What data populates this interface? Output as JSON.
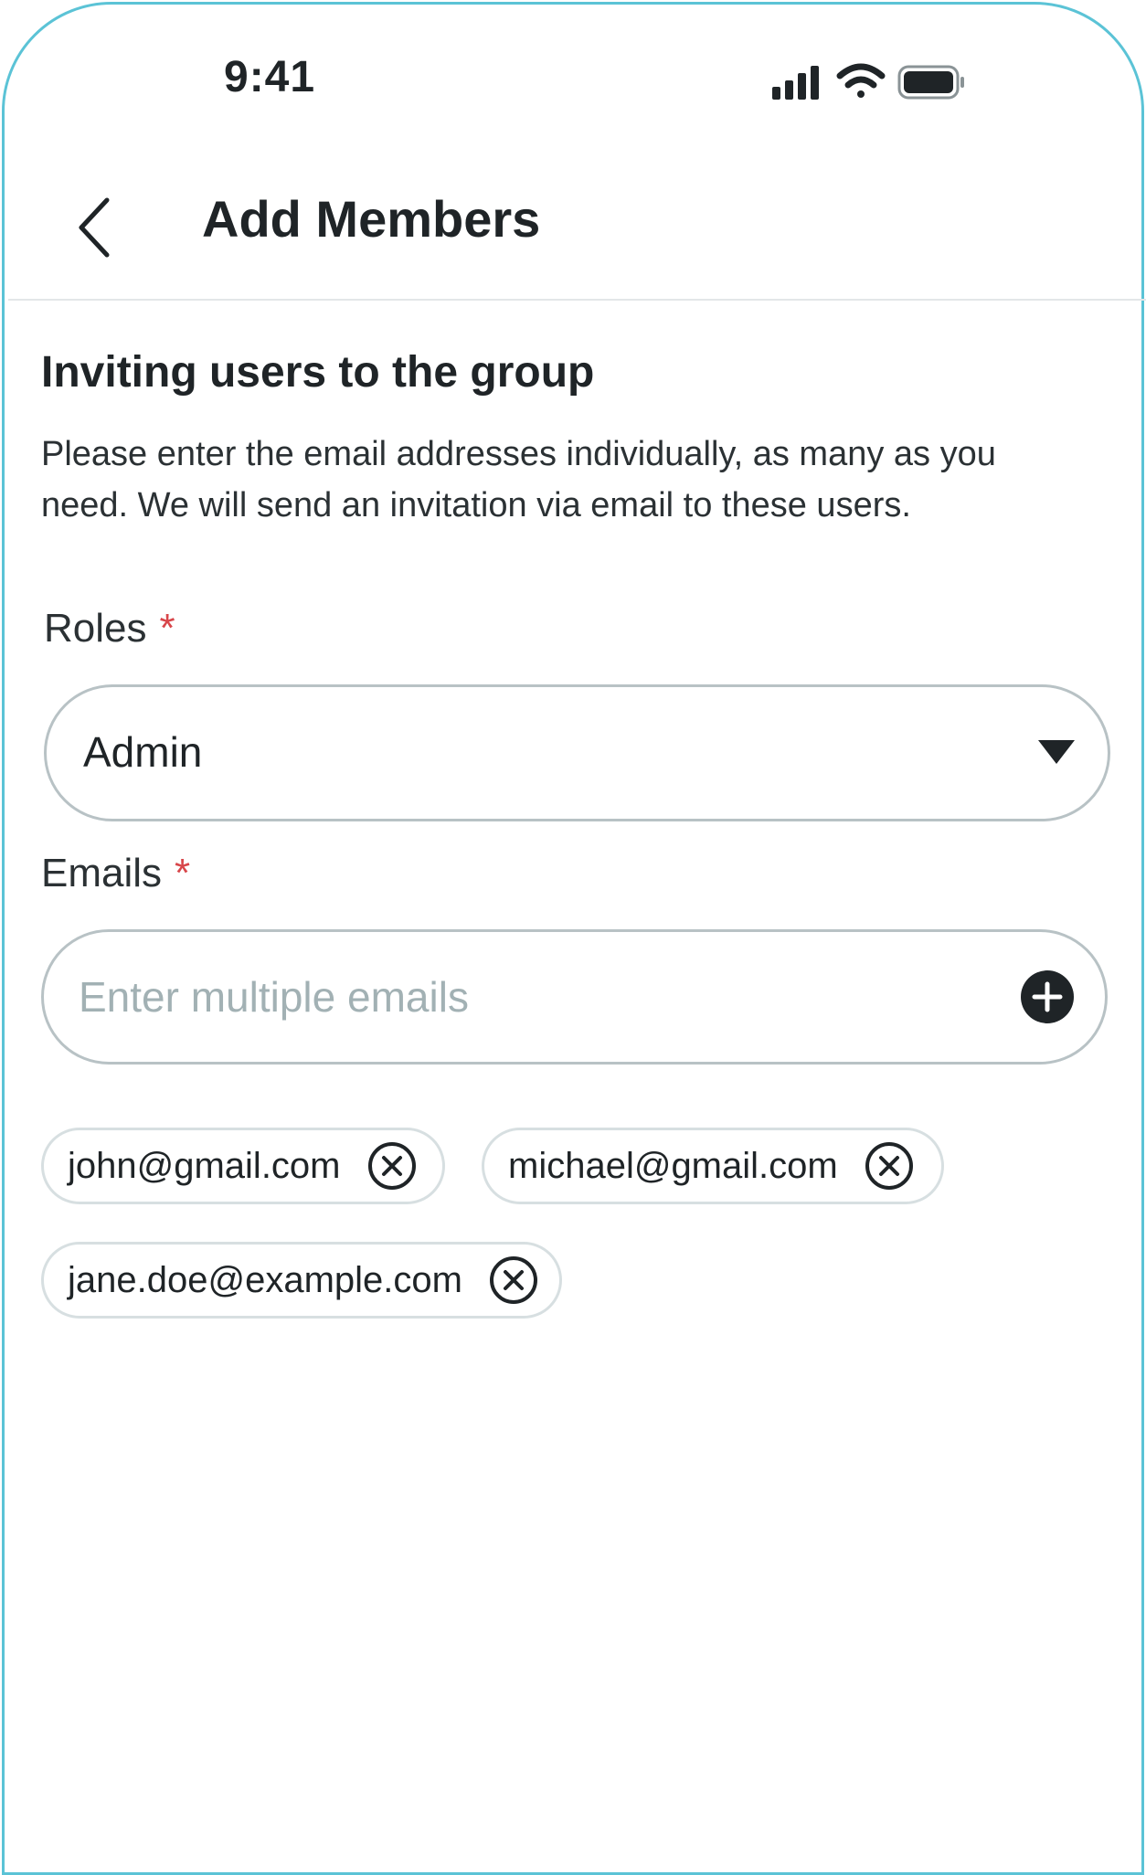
{
  "status_bar": {
    "time": "9:41",
    "icons": [
      "cellular-signal-icon",
      "wifi-icon",
      "battery-icon"
    ]
  },
  "header": {
    "back_icon": "chevron-left-icon",
    "title": "Add Members"
  },
  "intro": {
    "title": "Inviting users to the group",
    "description": "Please enter the email addresses individually, as many as you need. We will send an invitation via email to these users."
  },
  "roles": {
    "label": "Roles",
    "required_mark": "*",
    "selected": "Admin",
    "dropdown_icon": "caret-down-icon"
  },
  "emails": {
    "label": "Emails",
    "required_mark": "*",
    "placeholder": "Enter multiple emails",
    "value": "",
    "add_icon": "plus-circle-icon",
    "chips": [
      {
        "email": "john@gmail.com",
        "remove_icon": "close-circle-icon"
      },
      {
        "email": "michael@gmail.com",
        "remove_icon": "close-circle-icon"
      },
      {
        "email": "jane.doe@example.com",
        "remove_icon": "close-circle-icon"
      }
    ]
  },
  "colors": {
    "accent_border": "#5bc3d6",
    "text_primary": "#1f2427",
    "required": "#d8464a",
    "input_border": "#b8c2c5",
    "chip_border": "#d7dfe1",
    "placeholder": "#a2b1b4"
  }
}
